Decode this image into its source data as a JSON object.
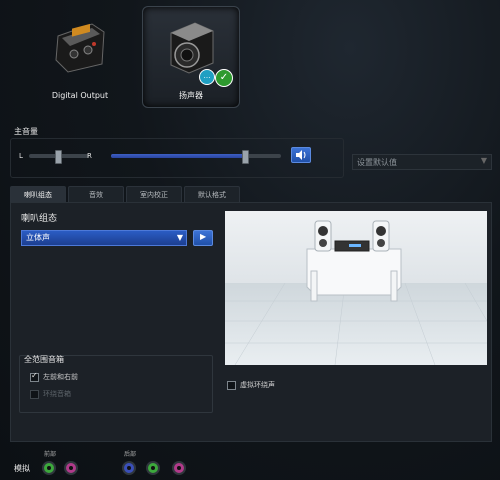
{
  "devices": [
    {
      "label": "Digital Output",
      "selected": false,
      "icon": "digital-output-icon"
    },
    {
      "label": "扬声器",
      "selected": true,
      "icon": "speaker-icon",
      "badges": [
        "chat-bubble-icon",
        "check-icon"
      ]
    }
  ],
  "master": {
    "title": "主音量",
    "left": "L",
    "right": "R",
    "balance_level": 0.5,
    "volume_level": 0.78
  },
  "default_dropdown": {
    "label": "设置默认值"
  },
  "tabs": [
    {
      "label": "喇叭组态",
      "active": true
    },
    {
      "label": "音效",
      "active": false
    },
    {
      "label": "室内校正",
      "active": false
    },
    {
      "label": "默认格式",
      "active": false
    }
  ],
  "config": {
    "title": "喇叭组态",
    "selected": "立体声"
  },
  "fullrange": {
    "title": "全范围音箱",
    "options": [
      {
        "label": "左前和右前",
        "checked": true,
        "enabled": true
      },
      {
        "label": "环绕音箱",
        "checked": false,
        "enabled": false
      }
    ]
  },
  "virtual_surround": {
    "label": "虚拟环绕声",
    "checked": false
  },
  "analog": {
    "label": "模拟",
    "front_label": "前部",
    "rear_label": "后部"
  },
  "colors": {
    "accent": "#2b5cc4",
    "green_jack": "#3ca83c",
    "pink_jack": "#b03a8a",
    "blue_jack": "#3a4fb8"
  }
}
